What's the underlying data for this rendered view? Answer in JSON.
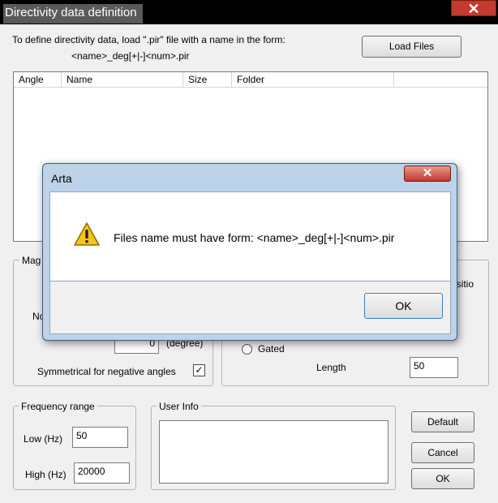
{
  "window": {
    "title": "Directivity data definition",
    "close_glyph": "✕",
    "instruction_line1": "To define directivity data, load \".pir\" file with a name in the form:",
    "instruction_line2": "<name>_deg[+|-]<num>.pir",
    "load_files_label": "Load Files",
    "list_columns": [
      "Angle",
      "Name",
      "Size",
      "Folder"
    ],
    "magnitude_group_label": "Mag",
    "partial_no_label": "No",
    "angle_value": "0",
    "degree_label": "(degree)",
    "symmetrical_label": "Symmetrical for negative angles",
    "symmetrical_checked": "✓",
    "partial_position_label": "ositio",
    "gated_label": "Gated",
    "length_label": "Length",
    "length_value": "50",
    "frequency_group_label": "Frequency range",
    "low_label": "Low (Hz)",
    "low_value": "50",
    "high_label": "High (Hz)",
    "high_value": "20000",
    "user_info_label": "User Info",
    "user_info_value": "",
    "default_label": "Default",
    "cancel_label": "Cancel",
    "ok_label": "OK"
  },
  "dialog": {
    "title": "Arta",
    "close_glyph": "✕",
    "message": "Files name must have form: <name>_deg[+|-]<num>.pir",
    "ok_label": "OK",
    "icon": "warning-icon"
  },
  "colors": {
    "titlebar_bg": "#000000",
    "close_red": "#c43a2e",
    "dialog_frame": "#bcd3ea",
    "warning_yellow": "#f5c518"
  }
}
